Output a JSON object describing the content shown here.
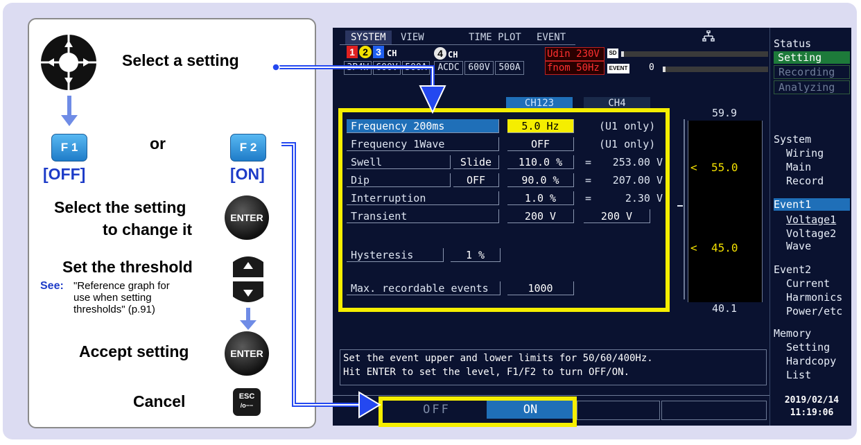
{
  "instructions": {
    "select_setting": "Select a setting",
    "or": "or",
    "f1_key": "F 1",
    "f1_label": "[OFF]",
    "f2_key": "F 2",
    "f2_label": "[ON]",
    "select_change_1": "Select the setting",
    "select_change_2": "to change it",
    "enter_key": "ENTER",
    "set_threshold": "Set the threshold",
    "see": "See:",
    "see_text_1": "\"Reference graph for",
    "see_text_2": "use when setting",
    "see_text_3": "thresholds\" (p.91)",
    "accept": "Accept setting",
    "cancel": "Cancel",
    "esc_key": "ESC",
    "esc_sub": "/o−−"
  },
  "screen": {
    "tabs": [
      "SYSTEM",
      "VIEW",
      "TIME PLOT",
      "EVENT"
    ],
    "ch123_label": "CH",
    "ch123_nums": [
      "1",
      "2",
      "3"
    ],
    "ch4_label": "CH",
    "ch4_num": "4",
    "ch123_info": [
      "3P4W",
      "600V",
      "500A"
    ],
    "ch4_info": [
      "ACDC",
      "600V",
      "500A"
    ],
    "udin": "Udin 230V",
    "fnom": "fnom  50Hz",
    "sd_label": "SD",
    "event_label": "EVENT",
    "event_count": "0",
    "col_headers": [
      "CH123",
      "CH4"
    ],
    "rows": [
      {
        "label": "Frequency 200ms",
        "v1": "5.0 Hz",
        "note": "(U1 only)"
      },
      {
        "label": "Frequency 1Wave",
        "v1": "OFF",
        "note": "(U1 only)"
      },
      {
        "label": "Swell",
        "mode": "Slide",
        "v1": "110.0 %",
        "eq": "=",
        "note": "253.00 V"
      },
      {
        "label": "Dip",
        "mode": "OFF",
        "v1": "90.0 %",
        "eq": "=",
        "note": "207.00 V"
      },
      {
        "label": "Interruption",
        "v1": "1.0 %",
        "eq": "=",
        "note": "2.30 V"
      },
      {
        "label": "Transient",
        "v1": "200 V",
        "v2": "200 V"
      },
      {
        "label": "Hysteresis",
        "v1": "1 %"
      },
      {
        "label": "Max. recordable events",
        "v1": "1000"
      }
    ],
    "graph": {
      "top": "59.9",
      "upper": "55.0",
      "lower": "45.0",
      "bottom": "40.1"
    },
    "sidebar": {
      "status_title": "Status",
      "status_items": [
        "Setting",
        "Recording",
        "Analyzing"
      ],
      "system_title": "System",
      "system_items": [
        "Wiring",
        "Main",
        "Record"
      ],
      "event1_title": "Event1",
      "event1_items": [
        "Voltage1",
        "Voltage2",
        "Wave"
      ],
      "event2_title": "Event2",
      "event2_items": [
        "Current",
        "Harmonics",
        "Power/etc"
      ],
      "memory_title": "Memory",
      "memory_items": [
        "Setting",
        "Hardcopy",
        "List"
      ],
      "date": "2019/02/14",
      "time": "11:19:06"
    },
    "message_1": "Set the event upper and lower limits for 50/60/400Hz.",
    "message_2": "Hit ENTER to set the level, F1/F2 to turn OFF/ON.",
    "softkeys": [
      "OFF",
      "ON"
    ]
  },
  "colors": {
    "highlight": "#f5ee00",
    "arrow": "#2448f0",
    "screen_bg": "#0a1230",
    "selected": "#1f6fb8"
  }
}
